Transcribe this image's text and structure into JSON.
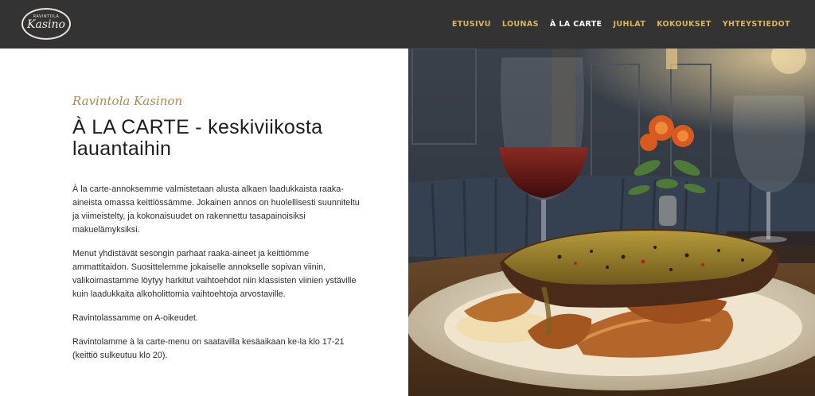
{
  "header": {
    "logo": {
      "small_text": "RAVINTOLA",
      "name": "Kasino"
    },
    "nav": [
      {
        "label": "ETUSIVU",
        "active": false
      },
      {
        "label": "LOUNAS",
        "active": false
      },
      {
        "label": "À LA CARTE",
        "active": true
      },
      {
        "label": "JUHLAT",
        "active": false
      },
      {
        "label": "KOKOUKSET",
        "active": false
      },
      {
        "label": "YHTEYSTIEDOT",
        "active": false
      }
    ]
  },
  "main": {
    "kicker": "Ravintola Kasinon",
    "title": "À LA CARTE - keskiviikosta lauantaihin",
    "paragraphs": [
      "À la carte-annoksemme valmistetaan alusta alkaen laadukkaista raaka-aineista omassa keittiössämme. Jokainen annos on huolellisesti suunniteltu ja viimeistelty, ja kokonaisuudet on rakennettu tasapainoisiksi makuelämyksiksi.",
      "Menut yhdistävät sesongin parhaat raaka-aineet ja keittiömme ammattitaidon. Suosittelemme jokaiselle annokselle sopivan viinin, valikoimastamme löytyy harkitut vaihtoehdot niin klassisten viinien ystäville kuin laadukkaita alkoholittomia vaihtoehtoja arvostaville.",
      "Ravintolassamme on A-oikeudet.",
      "Ravintolamme à la carte-menu on saatavilla kesäaikaan ke-la klo 17-21 (keittiö sulkeutuu klo 20)."
    ]
  },
  "colors": {
    "header_bg": "#333333",
    "nav_link": "#d9b563",
    "nav_active": "#ffffff",
    "kicker": "#b08a4f"
  }
}
